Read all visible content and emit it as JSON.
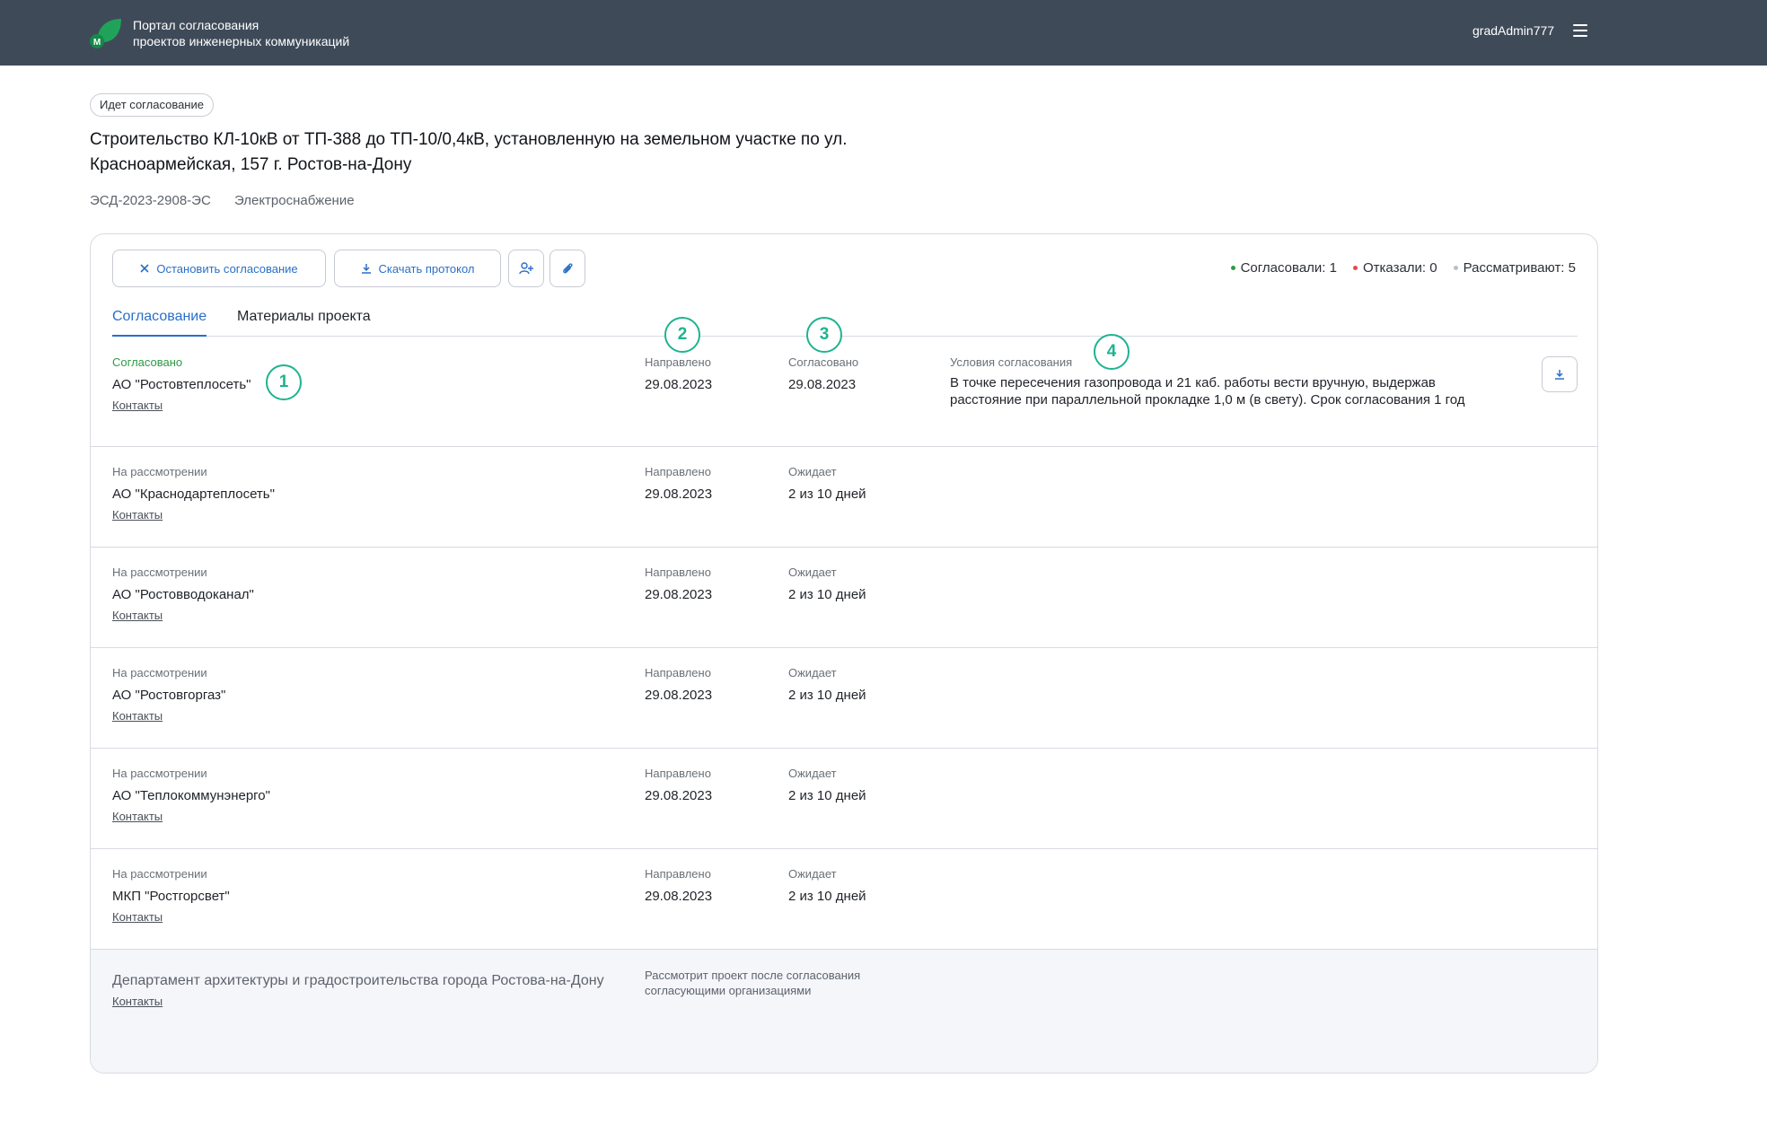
{
  "header": {
    "portal_line1": "Портал согласования",
    "portal_line2": "проектов инженерных коммуникаций",
    "username": "gradAdmin777",
    "logo_letter": "М",
    "logo_icon": "leaf-logo",
    "menu_icon": "hamburger-icon"
  },
  "project": {
    "status": "Идет согласование",
    "title": "Строительство КЛ-10кВ от ТП-388 до ТП-10/0,4кВ, установленную на земельном участке по ул. Красноармейская, 157 г. Ростов-на-Дону",
    "code": "ЭСД-2023-2908-ЭС",
    "type": "Электроснабжение"
  },
  "toolbar": {
    "stop_label": "Остановить согласование",
    "download_label": "Скачать протокол",
    "add_user_icon": "add-user-icon",
    "attach_icon": "paperclip-icon"
  },
  "counters": {
    "approved": "Согласовали: 1",
    "rejected": "Отказали: 0",
    "reviewing": "Рассматривают: 5",
    "colors": {
      "approved": "#2f9a45",
      "rejected": "#e24b4b",
      "reviewing": "#b8bfcc"
    }
  },
  "tabs": [
    {
      "label": "Согласование",
      "active": true
    },
    {
      "label": "Материалы проекта",
      "active": false
    }
  ],
  "rows": [
    {
      "status": "Согласовано",
      "org": "АО \"Ростовтеплосеть\"",
      "contacts": "Контакты",
      "sent_label": "Направлено",
      "sent_date": "29.08.2023",
      "second_label": "Согласовано",
      "second_value": "29.08.2023",
      "conditions_label": "Условия согласования",
      "conditions_text": "В точке пересечения газопровода и 21 каб. работы вести вручную, выдержав расстояние при параллельной прокладке 1,0 м (в свету). Срок согласования 1 год"
    },
    {
      "status": "На рассмотрении",
      "org": "АО \"Краснодартеплосеть\"",
      "contacts": "Контакты",
      "sent_label": "Направлено",
      "sent_date": "29.08.2023",
      "second_label": "Ожидает",
      "second_value": "2 из 10 дней"
    },
    {
      "status": "На рассмотрении",
      "org": "АО \"Ростовводоканал\"",
      "contacts": "Контакты",
      "sent_label": "Направлено",
      "sent_date": "29.08.2023",
      "second_label": "Ожидает",
      "second_value": "2 из 10 дней"
    },
    {
      "status": "На рассмотрении",
      "org": "АО \"Ростовгоргаз\"",
      "contacts": "Контакты",
      "sent_label": "Направлено",
      "sent_date": "29.08.2023",
      "second_label": "Ожидает",
      "second_value": "2 из 10 дней"
    },
    {
      "status": "На рассмотрении",
      "org": "АО \"Теплокоммунэнерго\"",
      "contacts": "Контакты",
      "sent_label": "Направлено",
      "sent_date": "29.08.2023",
      "second_label": "Ожидает",
      "second_value": "2 из 10 дней"
    },
    {
      "status": "На рассмотрении",
      "org": "МКП \"Ростгорсвет\"",
      "contacts": "Контакты",
      "sent_label": "Направлено",
      "sent_date": "29.08.2023",
      "second_label": "Ожидает",
      "second_value": "2 из 10 дней"
    }
  ],
  "final": {
    "org": "Департамент архитектуры и градостроительства города Ростова-на-Дону",
    "contacts": "Контакты",
    "note": "Рассмотрит проект после согласования согласующими организациями"
  },
  "markers": [
    "1",
    "2",
    "3",
    "4"
  ]
}
